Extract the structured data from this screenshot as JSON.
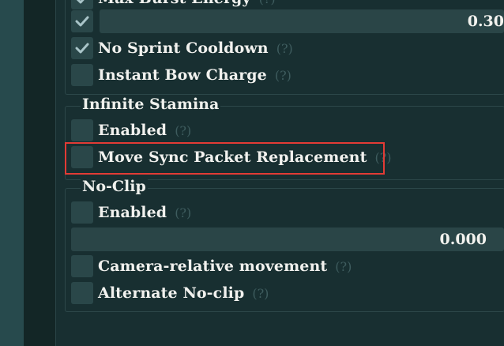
{
  "top_partial_label": "Max Burst Energy",
  "burst_slider_value": "0.30",
  "items_top": {
    "no_sprint_cooldown": "No Sprint Cooldown",
    "instant_bow_charge": "Instant Bow Charge"
  },
  "infinite_stamina": {
    "title": "Infinite Stamina",
    "enabled": "Enabled",
    "move_sync": "Move Sync Packet Replacement"
  },
  "no_clip": {
    "title": "No-Clip",
    "enabled": "Enabled",
    "slider_value": "0.000",
    "camera_relative": "Camera-relative movement",
    "alternate": "Alternate No-clip"
  },
  "help_text": "(?)",
  "states": {
    "max_burst_energy": true,
    "no_sprint_cooldown": true,
    "instant_bow_charge": false,
    "stamina_enabled": false,
    "move_sync": false,
    "noclip_enabled": false,
    "camera_relative": false,
    "alternate_noclip": false
  },
  "colors": {
    "highlight": "#e23b35",
    "checkmark": "#a9c4c8"
  }
}
